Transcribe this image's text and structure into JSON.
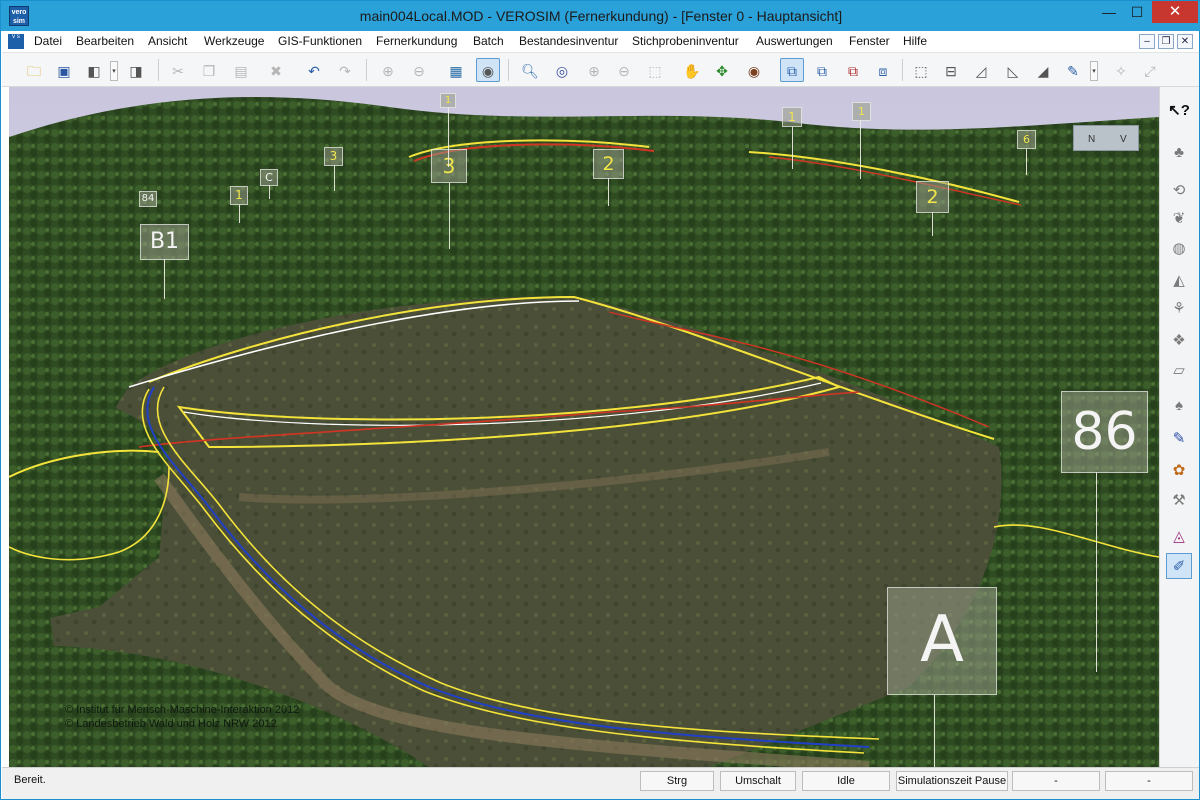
{
  "window": {
    "title": "main004Local.MOD - VEROSIM (Fernerkundung) - [Fenster 0 - Hauptansicht]",
    "app_icon_text": "vero sim",
    "controls": {
      "minimize": "—",
      "maximize": "☐",
      "close": "✕"
    }
  },
  "menu": {
    "items": [
      "Datei",
      "Bearbeiten",
      "Ansicht",
      "Werkzeuge",
      "GIS-Funktionen",
      "Fernerkundung",
      "Batch",
      "Bestandesinventur",
      "Stichprobeninventur",
      "Auswertungen",
      "Fenster",
      "Hilfe"
    ],
    "mdi_controls": {
      "minimize": "–",
      "restore": "❐",
      "close": "✕"
    }
  },
  "toolbar": {
    "icons": [
      "open-folder-icon",
      "save-icon",
      "box-icon",
      "view-drop-icon",
      "cut-icon",
      "copy-icon",
      "paste-icon",
      "delete-icon",
      "undo-icon",
      "redo-icon",
      "add-icon",
      "remove-icon",
      "map-icon",
      "camera-fly-icon",
      "zoom-icon",
      "rotate-eye-icon",
      "zoom-in-icon",
      "zoom-out-icon",
      "zoom-box-icon",
      "pan-hand-icon",
      "orbit-icon",
      "target-icon",
      "select-a-icon",
      "select-b-icon",
      "select-c-icon",
      "select-d-icon",
      "frame-a-icon",
      "frame-b-icon",
      "frame-c-icon",
      "frame-d-icon",
      "frame-e-icon",
      "measure-icon",
      "settings-a-icon",
      "settings-b-icon"
    ]
  },
  "viewport": {
    "colors": {
      "sky": "#c9c6de",
      "forest": "#2f4b22",
      "clearing": "#4e5236",
      "boundary_yellow": "#f3e33b",
      "boundary_red": "#d23524",
      "stream_blue": "#2040c8"
    },
    "labels": [
      {
        "text": "86",
        "style": "white"
      },
      {
        "text": "A",
        "style": "white"
      },
      {
        "text": "B1",
        "style": "white"
      },
      {
        "text": "84",
        "style": "white"
      },
      {
        "text": "C",
        "style": "white"
      },
      {
        "text": "1"
      },
      {
        "text": "3"
      },
      {
        "text": "3"
      },
      {
        "text": "2"
      },
      {
        "text": "2"
      },
      {
        "text": "1"
      },
      {
        "text": "1"
      },
      {
        "text": "1"
      },
      {
        "text": "6"
      }
    ],
    "copyright_lines": [
      "© Institut für Mensch-Maschine-Interaktion 2012",
      "© Landesbetrieb Wald und Holz NRW 2012"
    ],
    "nav_cube": {
      "n": "N",
      "v": "V"
    }
  },
  "rightbar": {
    "icons": [
      "help-pointer-icon",
      "tree-icon",
      "layers-icon",
      "leaf-icon",
      "globe-icon",
      "chart-icon",
      "branch-icon",
      "stack-icon",
      "list-icon",
      "measure-tree-icon",
      "pen-icon",
      "palette-icon",
      "tool-icon",
      "shape-icon",
      "brush-active-icon"
    ]
  },
  "statusbar": {
    "text": "Bereit.",
    "panels": [
      "Strg",
      "Umschalt",
      "Idle",
      "Simulationszeit  Pause",
      "-",
      "-"
    ]
  }
}
